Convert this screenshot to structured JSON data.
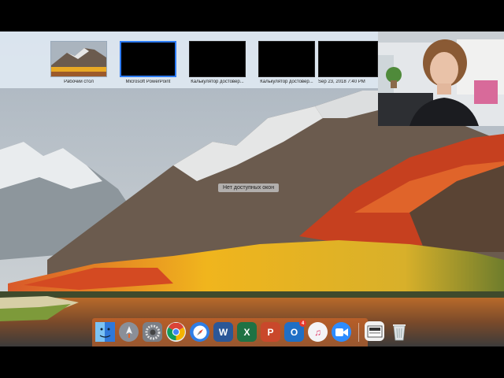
{
  "mission_control": {
    "desktops": [
      {
        "label": "Рабочий стол",
        "kind": "wallpaper",
        "selected": false
      },
      {
        "label": "Microsoft PowerPoint",
        "kind": "black",
        "selected": true
      },
      {
        "label": "Калькулятор достовер...",
        "kind": "black",
        "selected": false
      },
      {
        "label": "Калькулятор достовер...",
        "kind": "black",
        "selected": false
      },
      {
        "label": "Sep 23, 2018 7:40 PM",
        "kind": "black",
        "selected": false
      }
    ],
    "no_windows_label": "Нет доступных окон"
  },
  "dock": {
    "items": [
      {
        "name": "finder-icon",
        "color": "#3f8fe6"
      },
      {
        "name": "launchpad-icon",
        "color": "#8a8f98"
      },
      {
        "name": "system-preferences-icon",
        "color": "#7b7f86"
      },
      {
        "name": "chrome-icon",
        "color": "#e8eaed"
      },
      {
        "name": "safari-icon",
        "color": "#2f7ee6"
      },
      {
        "name": "word-icon",
        "color": "#2b5797",
        "glyph": "W"
      },
      {
        "name": "excel-icon",
        "color": "#1f7244",
        "glyph": "X"
      },
      {
        "name": "powerpoint-icon",
        "color": "#c9482b",
        "glyph": "P"
      },
      {
        "name": "outlook-icon",
        "color": "#1f6fc5",
        "glyph": "O",
        "badge": "4"
      },
      {
        "name": "itunes-icon",
        "color": "#f4f4f6",
        "glyph": "♫"
      },
      {
        "name": "zoom-icon",
        "color": "#2d8cff"
      },
      {
        "name": "preview-icon",
        "color": "#f2f2f2"
      },
      {
        "name": "trash-icon",
        "color": "#d9dde0"
      }
    ]
  },
  "colors": {
    "selection_border": "#2e7cf6",
    "dock_tint": "#e16e28",
    "badge": "#e8392d"
  }
}
